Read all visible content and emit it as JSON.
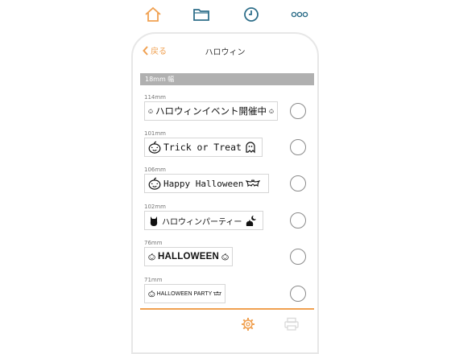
{
  "colors": {
    "accent": "#f0a050",
    "nav_blue": "#2f6f8a",
    "section_bg": "#b0b0b0"
  },
  "top_nav": {
    "icons": [
      "home-icon",
      "folder-icon",
      "clock-icon",
      "more-icon"
    ]
  },
  "header": {
    "back_label": "戻る",
    "title": "ハロウィン"
  },
  "section": {
    "label": "18mm 幅"
  },
  "items": [
    {
      "length": "114mm",
      "text": "ハロウィンイベント開催中",
      "icons": [
        "pumpkin-icon",
        "pumpkin-icon"
      ],
      "selected": false
    },
    {
      "length": "101mm",
      "text": "Trick or Treat",
      "icons": [
        "pumpkin-icon",
        "ghost-icon"
      ],
      "selected": false
    },
    {
      "length": "106mm",
      "text": "Happy Halloween",
      "icons": [
        "pumpkin-icon",
        "bat-icon"
      ],
      "selected": false
    },
    {
      "length": "102mm",
      "text": "ハロウィンパーティー",
      "icons": [
        "cat-icon",
        "cat-moon-icon"
      ],
      "selected": false
    },
    {
      "length": "76mm",
      "text": "HALLOWEEN",
      "icons": [
        "pumpkin-icon",
        "pumpkin-icon"
      ],
      "selected": false
    },
    {
      "length": "71mm",
      "text": "HALLOWEEN PARTY",
      "icons": [
        "pumpkin-icon",
        "bat-icon"
      ],
      "selected": false
    }
  ],
  "bottom_bar": {
    "icons": [
      "gear-icon",
      "printer-icon"
    ]
  }
}
